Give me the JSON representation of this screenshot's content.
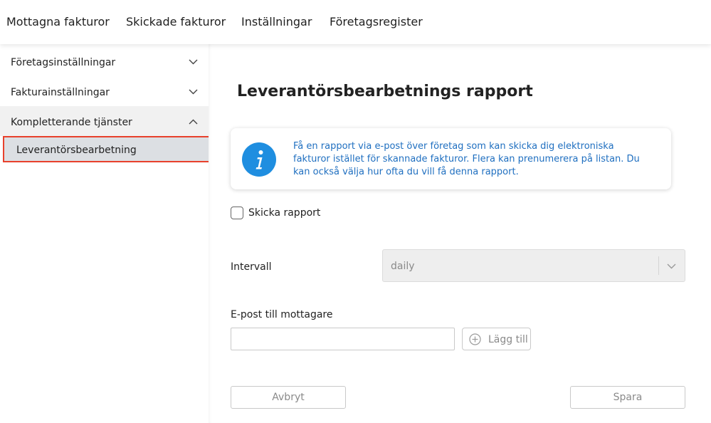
{
  "topnav": {
    "tabs": [
      {
        "label": "Mottagna fakturor"
      },
      {
        "label": "Skickade fakturor"
      },
      {
        "label": "Inställningar"
      },
      {
        "label": "Företagsregister"
      }
    ]
  },
  "sidebar": {
    "items": [
      {
        "label": "Företagsinställningar",
        "icon": "chevron-down-icon"
      },
      {
        "label": "Fakturainställningar",
        "icon": "chevron-down-icon"
      },
      {
        "label": "Kompletterande tjänster",
        "icon": "chevron-up-icon"
      }
    ],
    "subitem": {
      "label": "Leverantörsbearbetning"
    }
  },
  "main": {
    "title": "Leverantörsbearbetnings rapport",
    "info": {
      "icon": "info-icon",
      "text": "Få en rapport via e-post över företag som kan skicka dig elektroniska fakturor istället för skannade fakturor. Flera kan prenumerera på listan. Du kan också välja hur ofta du vill få denna rapport."
    },
    "send_report": {
      "label": "Skicka rapport",
      "checked": false
    },
    "interval": {
      "label": "Intervall",
      "value": "daily"
    },
    "email": {
      "label": "E-post till mottagare",
      "value": "",
      "add_label": "Lägg till"
    },
    "cancel_label": "Avbryt",
    "save_label": "Spara"
  },
  "colors": {
    "accent": "#1f6fc0",
    "info_icon": "#1f8ee0",
    "highlight_border": "#e8412c",
    "selected_bg": "#dcdfe3"
  }
}
